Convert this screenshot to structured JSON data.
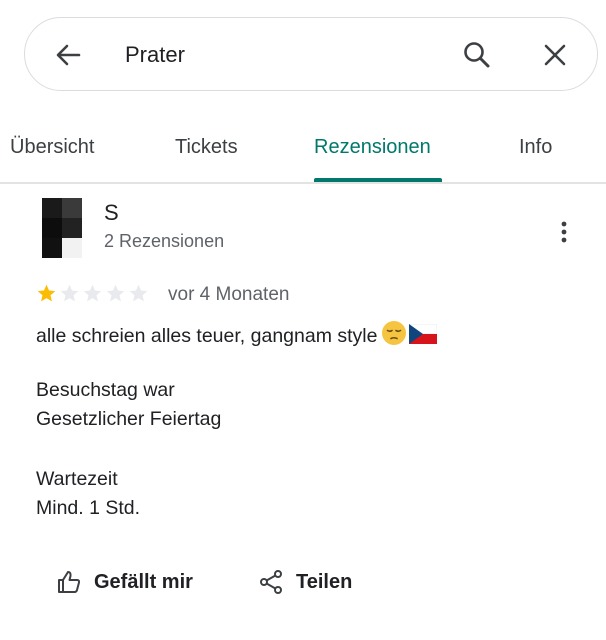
{
  "search": {
    "query": "Prater"
  },
  "tabs": [
    {
      "label": "Übersicht",
      "active": false
    },
    {
      "label": "Tickets",
      "active": false
    },
    {
      "label": "Rezensionen",
      "active": true
    },
    {
      "label": "Info",
      "active": false
    }
  ],
  "review": {
    "author": "S",
    "author_meta": "2 Rezensionen",
    "rating": 1,
    "rating_max": 5,
    "time": "vor 4 Monaten",
    "text": "alle schreien alles teuer, gangnam style",
    "emojis": [
      "pensive-face-emoji",
      "czech-flag-emoji"
    ],
    "details": [
      {
        "label": "Besuchstag war",
        "value": "Gesetzlicher Feiertag"
      },
      {
        "label": "Wartezeit",
        "value": "Mind. 1 Std."
      }
    ]
  },
  "actions": {
    "like_label": "Gefällt mir",
    "share_label": "Teilen"
  },
  "colors": {
    "accent": "#00796b",
    "star_filled": "#fbbc04",
    "star_empty": "#e8eaed"
  }
}
